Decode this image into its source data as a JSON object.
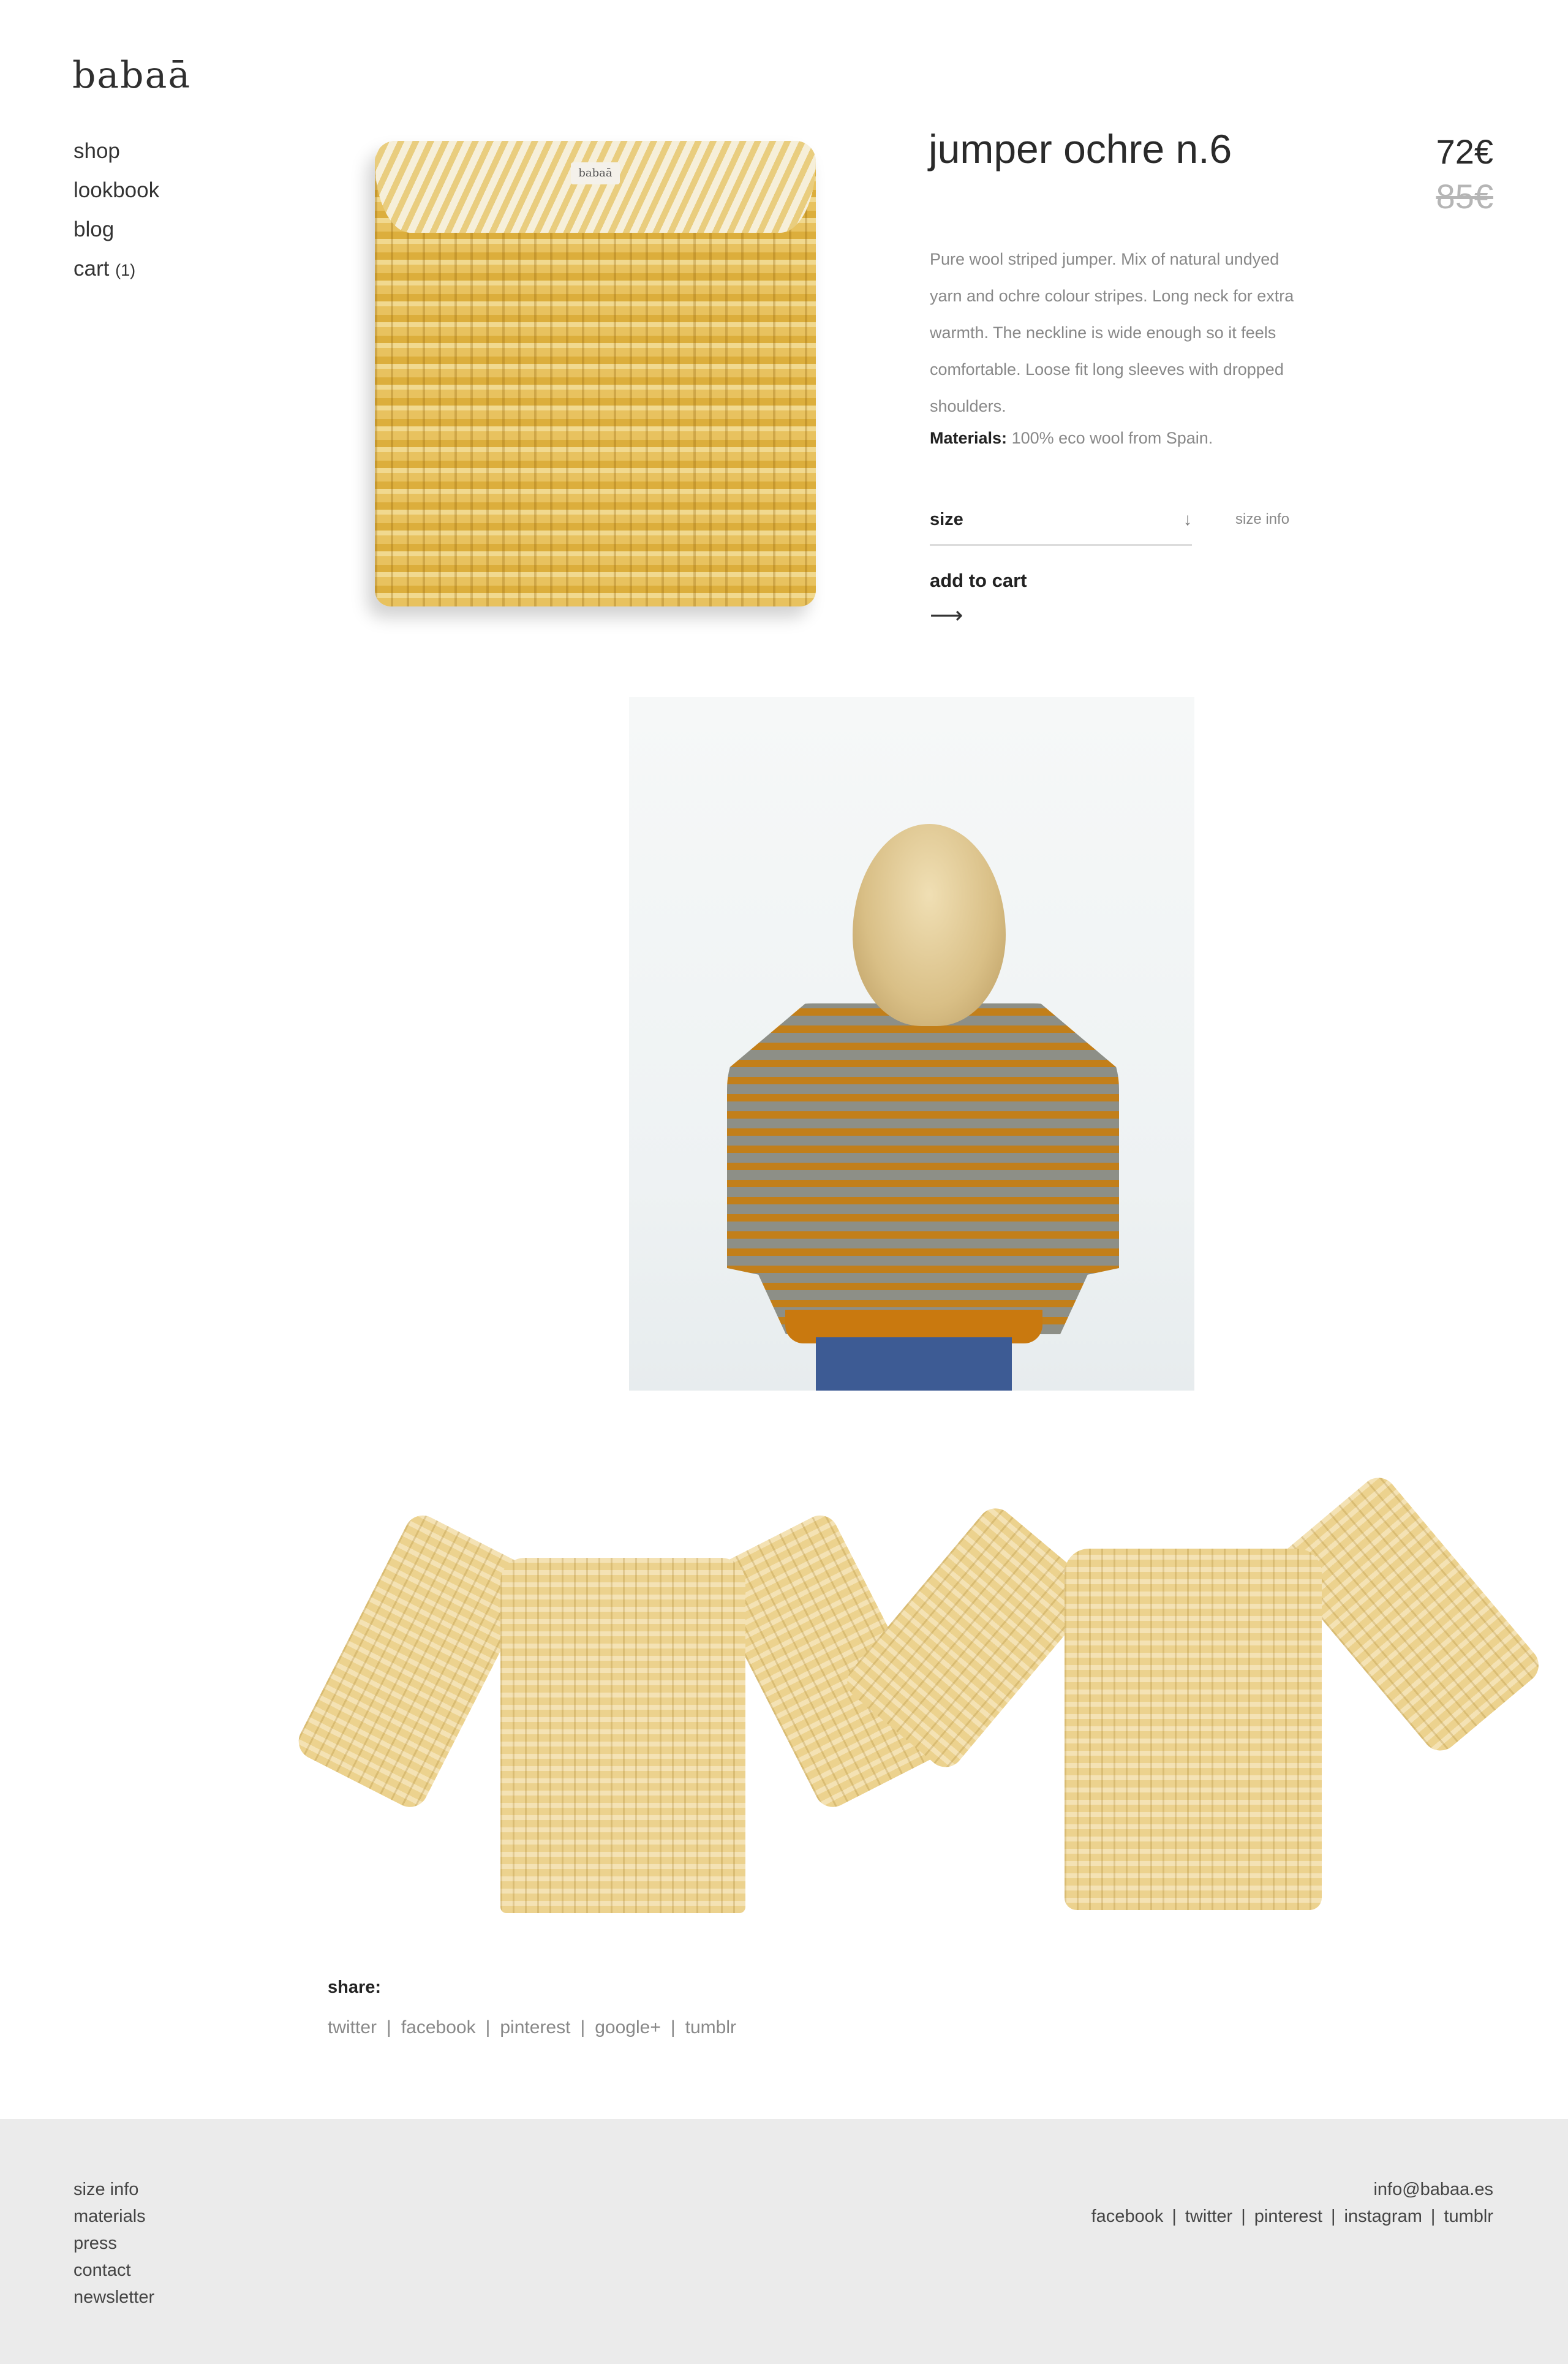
{
  "brand": {
    "logo": "babaā"
  },
  "nav": {
    "shop": "shop",
    "lookbook": "lookbook",
    "blog": "blog",
    "cart": "cart",
    "cart_count": "(1)"
  },
  "product": {
    "title": "jumper ochre n.6",
    "price": "72€",
    "old_price": "85€",
    "description": "Pure wool striped jumper. Mix of natural undyed yarn and ochre colour stripes. Long neck for extra warmth. The neckline is wide enough so it feels comfortable. Loose fit long sleeves with dropped shoulders.",
    "materials_label": "Materials:",
    "materials_value": "100% eco wool from Spain.",
    "size_label": "size",
    "size_arrow": "↓",
    "size_info": "size info",
    "add_to_cart": "add to cart",
    "add_to_cart_arrow": "⟶",
    "tag_label": "babaā"
  },
  "share": {
    "label": "share:",
    "links": [
      "twitter",
      "facebook",
      "pinterest",
      "google+",
      "tumblr"
    ]
  },
  "footer": {
    "nav": [
      "size info",
      "materials",
      "press",
      "contact",
      "newsletter"
    ],
    "email": "info@babaa.es",
    "social": [
      "facebook",
      "twitter",
      "pinterest",
      "instagram",
      "tumblr"
    ]
  },
  "colors": {
    "ochre": "#d9a93a",
    "footer_bg": "#ebebeb",
    "muted_text": "#888888"
  }
}
